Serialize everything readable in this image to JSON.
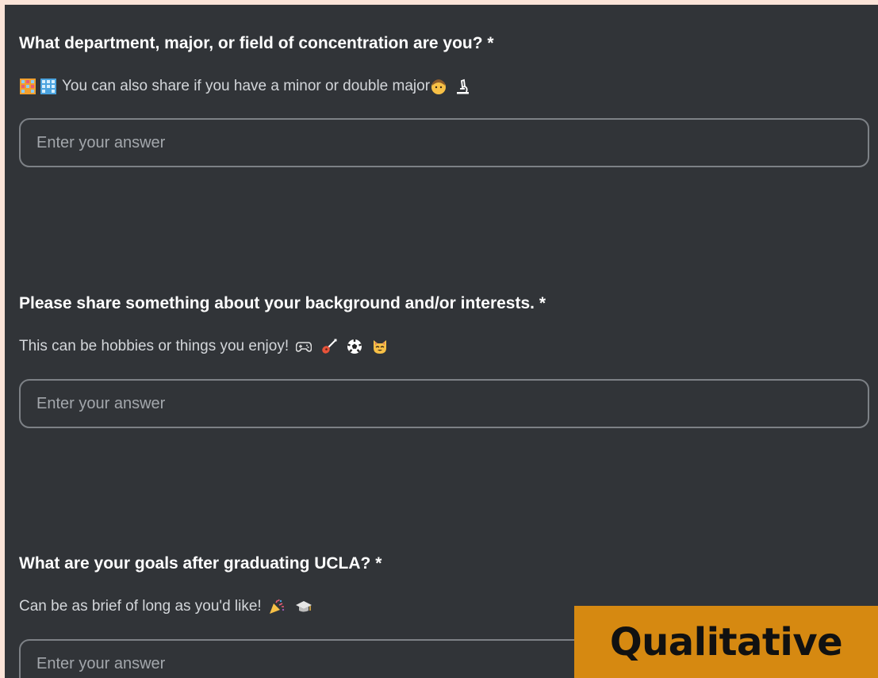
{
  "questions": [
    {
      "title": "What department, major, or field of concentration are you? *",
      "subtitle_before": "",
      "subtitle_text": "You can also share if you have a minor or double major",
      "leading_icons": [
        "building-icon",
        "office-building-icon"
      ],
      "trailing_icons": [
        "student-face-icon",
        "microscope-icon"
      ],
      "placeholder": "Enter your answer"
    },
    {
      "title": "Please share something about your background and/or interests. *",
      "subtitle_text": "This can be hobbies or things you enjoy!",
      "trailing_icons": [
        "game-controller-icon",
        "guitar-icon",
        "soccer-ball-icon",
        "cat-face-icon"
      ],
      "placeholder": "Enter your answer"
    },
    {
      "title": "What are your goals after graduating UCLA? *",
      "subtitle_text": "Can be as brief of long as you'd like!",
      "trailing_icons": [
        "party-popper-icon",
        "graduation-cap-icon"
      ],
      "placeholder": "Enter your answer"
    }
  ],
  "badge": {
    "label": "Qualitative"
  },
  "colors": {
    "page_border": "#fbe4d8",
    "panel_bg": "#313438",
    "input_border": "#7d8186",
    "badge_bg": "#d68911"
  }
}
